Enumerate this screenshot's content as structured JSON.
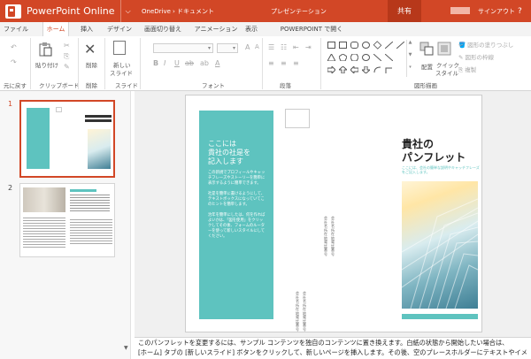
{
  "titlebar": {
    "app_name": "PowerPoint Online",
    "breadcrumb_1": "OneDrive",
    "breadcrumb_sep": "›",
    "breadcrumb_2": "ドキュメント",
    "document_title": "プレゼンテーション",
    "share_label": "共有",
    "signin_label": "サインアウト",
    "help_label": "?"
  },
  "tabs": [
    "ファイル",
    "ホーム",
    "挿入",
    "デザイン",
    "画面切り替え",
    "アニメーション",
    "表示",
    "POWERPOINT で開く"
  ],
  "active_tab": "ホーム",
  "ribbon": {
    "undo_group": "元に戻す",
    "clipboard": {
      "paste": "貼り付け",
      "copy_label": "クリップボード"
    },
    "delete": {
      "label": "削除",
      "group": "削除"
    },
    "slides": {
      "new_slide_line1": "新しい",
      "new_slide_line2": "スライド",
      "group": "スライド"
    },
    "font_group": "フォント",
    "paragraph_group": "段落",
    "drawing": {
      "arrange": "配置",
      "quick_style_1": "クイック",
      "quick_style_2": "スタイル",
      "fill": "図形の塗りつぶし",
      "outline": "図形の枠線",
      "duplicate": "複製",
      "group": "図形描画"
    }
  },
  "thumbnails": [
    {
      "number": "1",
      "selected": true
    },
    {
      "number": "2",
      "selected": false
    }
  ],
  "slide": {
    "left_title": "ここには\n貴社の社是を\n記入します",
    "left_body": "この新規でプロフィールやキャッチフレーズやストーリーを簡単に表示するように簡単できます。\n\n社是を簡単に書けるようにして、テキストボックスになっていてこのヒントを簡単します。\n\n治年を簡単にしたは、何を作ればよいかは、「図を使用」をクリックしてその後、フォームのルーターを使って新しいスタイルにしてください。",
    "middle_vertical_1": "会社名所在地電話番号",
    "middle_vertical_2": "会社名所在地電話番号",
    "title": "貴社の\nパンフレット",
    "subtitle": "ここには、会社の簡単な説明やキャッチフレーズをご記入します。"
  },
  "notes": {
    "line1": "このパンフレットを変更するには、サンプル コンテンツを独自のコンテンツに置き換えます。白紙の状態から開始したい場合は、",
    "line2": "[ホーム] タブの [新しいスライド] ボタンをクリックして、新しいページを挿入します。その後、空のプレースホルダーにテキストやイメ"
  },
  "colors": {
    "accent": "#d24726",
    "teal": "#5ec3bf"
  }
}
